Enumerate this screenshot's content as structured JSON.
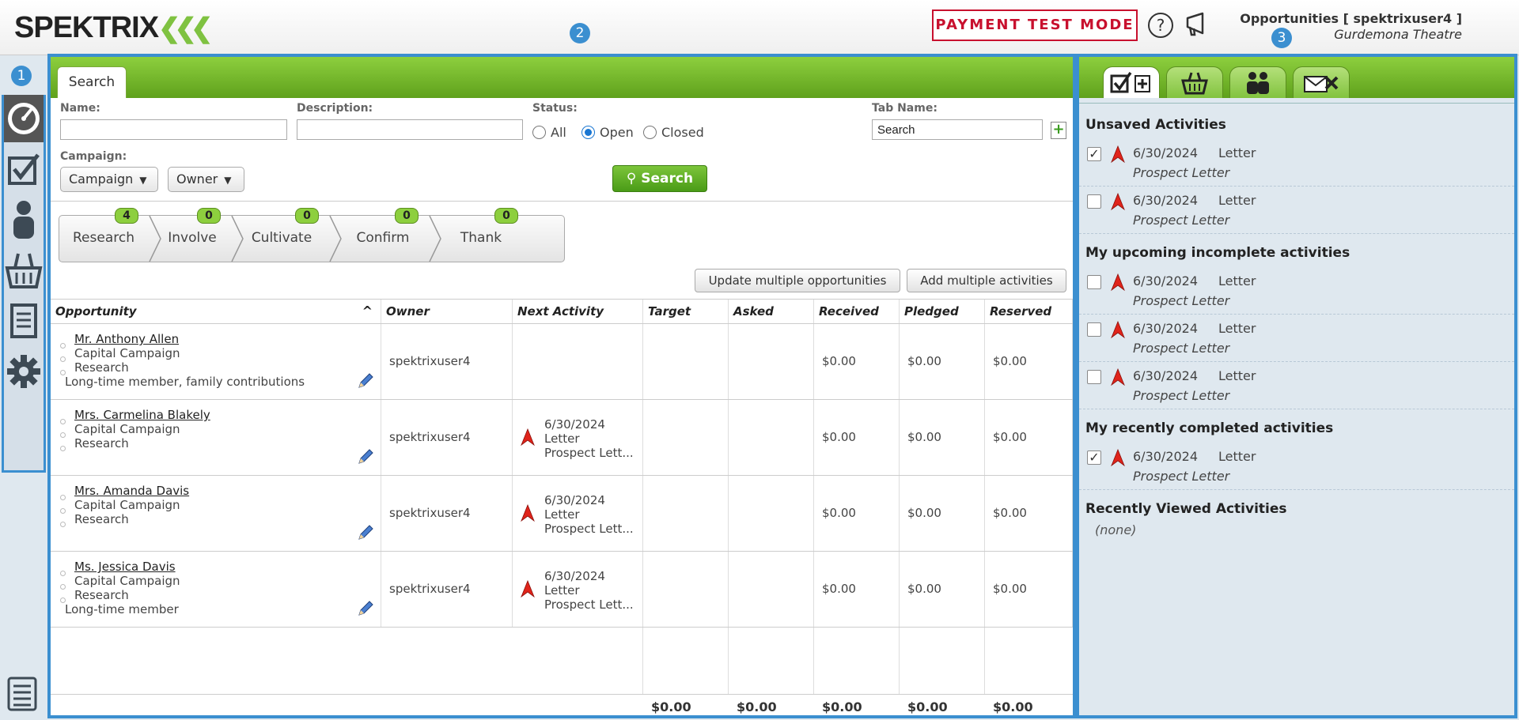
{
  "header": {
    "logo_text": "SPEKTRIX",
    "payment_mode": "PAYMENT TEST MODE",
    "help_glyph": "?",
    "context_title": "Opportunities [ spektrixuser4 ]",
    "context_subtitle": "Gurdemona Theatre"
  },
  "callouts": [
    "1",
    "2",
    "3"
  ],
  "nav": {
    "items": [
      "dashboard-icon",
      "activities-icon",
      "contacts-icon",
      "basket-icon",
      "reports-icon",
      "settings-icon"
    ]
  },
  "main": {
    "tab_label": "Search",
    "form": {
      "name_label": "Name:",
      "name_value": "",
      "description_label": "Description:",
      "description_value": "",
      "status_label": "Status:",
      "status_options": [
        "All",
        "Open",
        "Closed"
      ],
      "status_selected": "Open",
      "tab_name_label": "Tab Name:",
      "tab_name_value": "Search",
      "add_tab_glyph": "+",
      "campaign_label": "Campaign:",
      "campaign_dropdown": "Campaign",
      "owner_dropdown": "Owner",
      "search_button": "Search"
    },
    "pipeline": [
      {
        "label": "Research",
        "count": "4"
      },
      {
        "label": "Involve",
        "count": "0"
      },
      {
        "label": "Cultivate",
        "count": "0"
      },
      {
        "label": "Confirm",
        "count": "0"
      },
      {
        "label": "Thank",
        "count": "0"
      }
    ],
    "actions": {
      "update_multiple": "Update multiple opportunities",
      "add_multiple": "Add multiple activities"
    },
    "table": {
      "sort_glyph": "^",
      "columns": [
        "Opportunity",
        "Owner",
        "Next Activity",
        "Target",
        "Asked",
        "Received",
        "Pledged",
        "Reserved"
      ],
      "rows": [
        {
          "name": "Mr. Anthony Allen",
          "campaign": "Capital Campaign",
          "stage": "Research",
          "note": "Long-time member, family contributions",
          "owner": "spektrixuser4",
          "next_date": "",
          "next_type": "",
          "next_desc": "",
          "target": "",
          "asked": "",
          "received": "$0.00",
          "pledged": "$0.00",
          "reserved": "$0.00"
        },
        {
          "name": "Mrs. Carmelina Blakely",
          "campaign": "Capital Campaign",
          "stage": "Research",
          "note": "",
          "owner": "spektrixuser4",
          "next_date": "6/30/2024",
          "next_type": "Letter",
          "next_desc": "Prospect Lett...",
          "target": "",
          "asked": "",
          "received": "$0.00",
          "pledged": "$0.00",
          "reserved": "$0.00"
        },
        {
          "name": "Mrs. Amanda Davis",
          "campaign": "Capital Campaign",
          "stage": "Research",
          "note": "",
          "owner": "spektrixuser4",
          "next_date": "6/30/2024",
          "next_type": "Letter",
          "next_desc": "Prospect Lett...",
          "target": "",
          "asked": "",
          "received": "$0.00",
          "pledged": "$0.00",
          "reserved": "$0.00"
        },
        {
          "name": "Ms. Jessica Davis",
          "campaign": "Capital Campaign",
          "stage": "Research",
          "note": "Long-time member",
          "owner": "spektrixuser4",
          "next_date": "6/30/2024",
          "next_type": "Letter",
          "next_desc": "Prospect Lett...",
          "target": "",
          "asked": "",
          "received": "$0.00",
          "pledged": "$0.00",
          "reserved": "$0.00"
        }
      ],
      "totals": {
        "target": "$0.00",
        "asked": "$0.00",
        "received": "$0.00",
        "pledged": "$0.00",
        "reserved": "$0.00"
      }
    }
  },
  "right": {
    "tabs": [
      "activities-add-icon",
      "basket-icon",
      "contacts-icon",
      "mail-icon"
    ],
    "sections": {
      "unsaved": "Unsaved Activities",
      "upcoming": "My upcoming incomplete activities",
      "completed": "My recently completed activities",
      "recent": "Recently Viewed Activities"
    },
    "unsaved_items": [
      {
        "checked": true,
        "date": "6/30/2024",
        "type": "Letter",
        "desc": "Prospect Letter"
      },
      {
        "checked": false,
        "date": "6/30/2024",
        "type": "Letter",
        "desc": "Prospect Letter"
      }
    ],
    "upcoming_items": [
      {
        "checked": false,
        "date": "6/30/2024",
        "type": "Letter",
        "desc": "Prospect Letter"
      },
      {
        "checked": false,
        "date": "6/30/2024",
        "type": "Letter",
        "desc": "Prospect Letter"
      },
      {
        "checked": false,
        "date": "6/30/2024",
        "type": "Letter",
        "desc": "Prospect Letter"
      }
    ],
    "completed_items": [
      {
        "checked": true,
        "date": "6/30/2024",
        "type": "Letter",
        "desc": "Prospect Letter"
      }
    ],
    "recent_none": "(none)",
    "check_glyph": "✓"
  },
  "colors": {
    "accent_green": "#7cc53a",
    "callout_blue": "#3b8fd0",
    "alert_red": "#c8102e"
  }
}
